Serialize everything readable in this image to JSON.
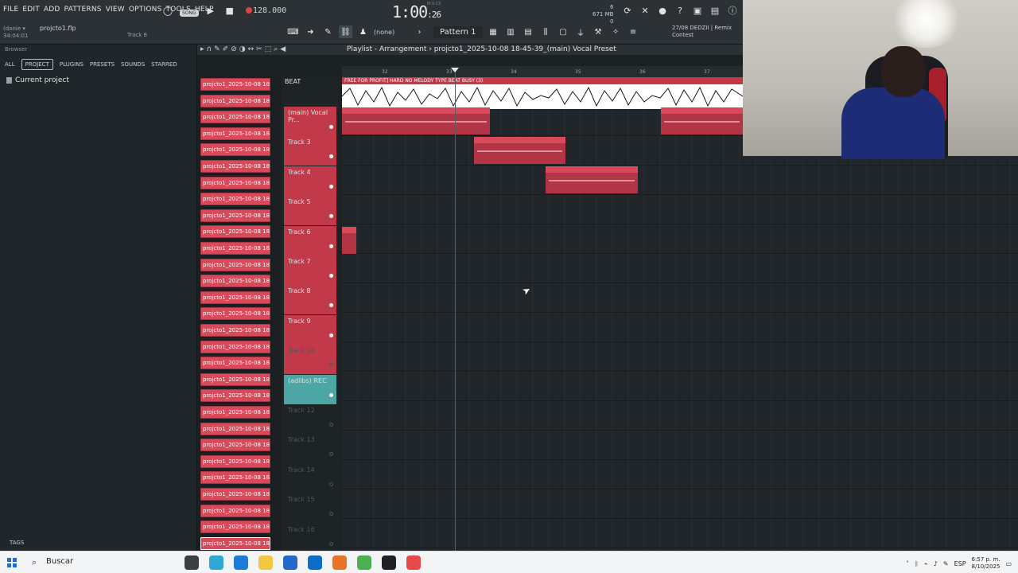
{
  "menu": [
    "FILE",
    "EDIT",
    "ADD",
    "PATTERNS",
    "VIEW",
    "OPTIONS",
    "TOOLS",
    "HELP"
  ],
  "transport": {
    "song_mode": "SONG",
    "tempo": "128.000",
    "time_main": "1:00",
    "time_sub": ":26",
    "time_unit": "M:S:CS"
  },
  "project": {
    "user_hint": "(danie ▾",
    "time_hint": "34:04:01",
    "file": "projcto1.flp",
    "track_hint": "Track 8"
  },
  "system": {
    "cpu_top": "6",
    "ram": "671 MB",
    "ram_sub": "0"
  },
  "news": {
    "line1": "27/08  DEDZII | Remix",
    "line2": "Contest"
  },
  "toolbar": {
    "snap": "(none)",
    "pattern": "Pattern 1"
  },
  "browser": {
    "title": "Browser",
    "tabs": [
      "ALL",
      "PROJECT",
      "PLUGINS",
      "PRESETS",
      "SOUNDS",
      "STARRED"
    ],
    "active_tab": "PROJECT",
    "tree_item": "Current project",
    "tags": "TAGS"
  },
  "playlist": {
    "title": "Playlist - Arrangement",
    "breadcrumb": "projcto1_2025-10-08 18-45-39_(main) Vocal Preset",
    "ruler": [
      "32",
      "33",
      "34",
      "35",
      "36",
      "37"
    ],
    "beat_label": "BEAT",
    "beat_clip": "FREE FOR PROFIT] HARD NO MELODY TYPE BEAT BUSY (3)",
    "clips": [
      "projcto1_2025-10-08 18-09-12_(main) Vocal Preset",
      "projcto1_2025-1...in) Vocal Preset",
      "projcto1_2025-10...in) Vocal Preset",
      "projcto1_2025-10...in) Vocal Preset"
    ]
  },
  "insert_label": "projcto1_2025-10-08 18...",
  "tracks": [
    {
      "name": "(main) Vocal Pr...",
      "style": "red"
    },
    {
      "name": "Track 3",
      "style": "red"
    },
    {
      "name": "Track 4",
      "style": "red"
    },
    {
      "name": "Track 5",
      "style": "red"
    },
    {
      "name": "Track 6",
      "style": "red"
    },
    {
      "name": "Track 7",
      "style": "red"
    },
    {
      "name": "Track 8",
      "style": "red"
    },
    {
      "name": "Track 9",
      "style": "red"
    },
    {
      "name": "Track 10",
      "style": "red-dim"
    },
    {
      "name": "(adlibs) REC",
      "style": "teal"
    },
    {
      "name": "Track 12",
      "style": "dim"
    },
    {
      "name": "Track 13",
      "style": "dim"
    },
    {
      "name": "Track 14",
      "style": "dim"
    },
    {
      "name": "Track 15",
      "style": "dim"
    },
    {
      "name": "Track 16",
      "style": "dim"
    }
  ],
  "taskbar": {
    "search": "Buscar",
    "lang": "ESP",
    "time": "6:57 p. m.",
    "date": "8/10/2025"
  },
  "colors": {
    "clip_red": "#d84a5a",
    "teal": "#4ba6a4",
    "accent": "#e04242"
  }
}
